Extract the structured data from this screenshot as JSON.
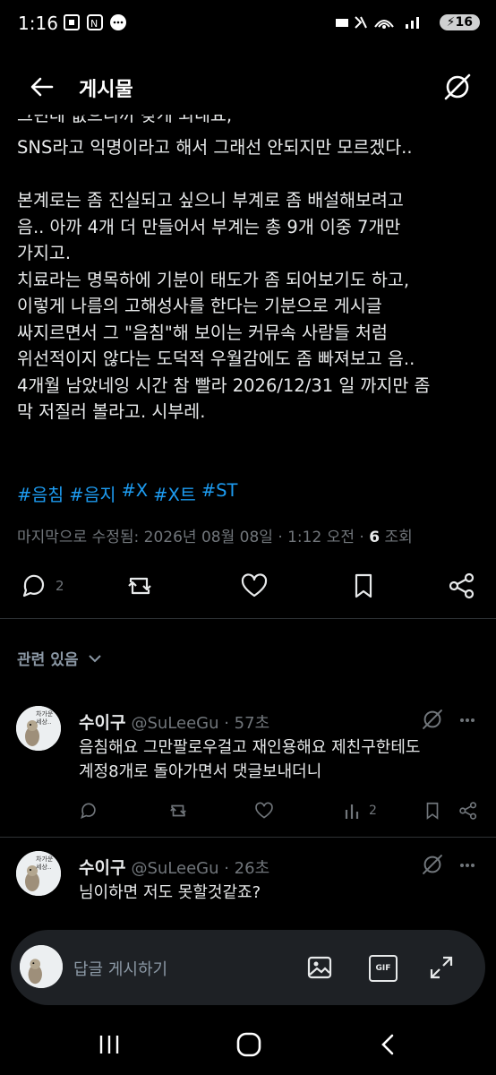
{
  "status_bar": {
    "time": "1:16",
    "battery": "16"
  },
  "header": {
    "title": "게시물"
  },
  "post": {
    "truncated_line": "그런데 없으니까 갖게 되네요,",
    "text": "SNS라고 익명이라고 해서 그래선 안되지만 모르겠다..\n\n본계로는 좀 진실되고 싶으니 부계로 좀 배설해보려고\n음.. 아까 4개 더 만들어서 부계는 총 9개 이중 7개만\n가지고.\n치료라는 명목하에 기분이 태도가 좀 되어보기도 하고,\n이렇게 나름의 고해성사를 한다는 기분으로 게시글\n싸지르면서 그 \"음침\"해 보이는 커뮤속 사람들 처럼\n위선적이지 않다는 도덕적 우월감에도 좀 빠져보고 음..\n4개월 남았네잉 시간 참 빨라 2026/12/31 일 까지만 좀\n막 저질러 볼라고. 시부레.",
    "hashtags": [
      "#음침",
      "#음지",
      "#X",
      "#X트",
      "#ST"
    ],
    "meta_prefix": "마지막으로 수정됨: 2026년 08월 08일 · 1:12 오전 · ",
    "views": "6",
    "views_label": " 조회",
    "reply_count": "2"
  },
  "related": {
    "label": "관련 있음"
  },
  "replies": [
    {
      "name": "수이구",
      "handle": "@SuLeeGu · 57초",
      "text": "음침해요 그만팔로우걸고 재인용해요 제친구한테도\n계정8개로 돌아가면서 댓글보내더니",
      "views": "2",
      "avatar_text": "차가운 세상.."
    },
    {
      "name": "수이구",
      "handle": "@SuLeeGu · 26초",
      "text": "님이하면 저도 못할것같죠?",
      "avatar_text": "차가운 세상.."
    }
  ],
  "composer": {
    "placeholder": "답글 게시하기",
    "gif_label": "GIF"
  },
  "colors": {
    "accent": "#1d9bf0",
    "muted": "#71767b",
    "text": "#e7e9ea"
  }
}
